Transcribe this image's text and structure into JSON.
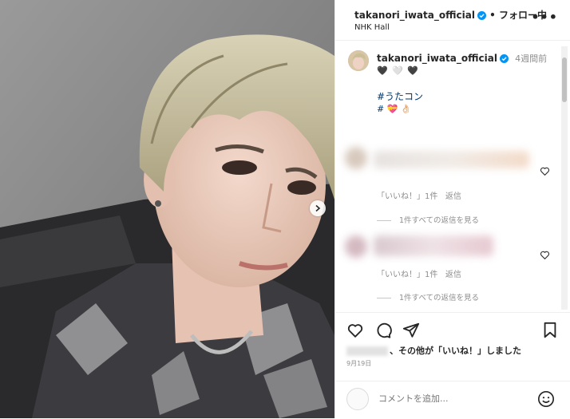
{
  "header": {
    "username": "takanori_iwata_official",
    "separator": "•",
    "follow_status": "フォロー中",
    "location": "NHK Hall",
    "more_label": "•••"
  },
  "caption": {
    "username": "takanori_iwata_official",
    "time": "4週間前",
    "hearts": "🖤 🤍 🖤",
    "hashtag": "#うたコン",
    "emoji_tags": "# 💝 👌🏻"
  },
  "comments": [
    {
      "likes": "「いいね！」1件",
      "reply": "返信",
      "view_replies": "1件すべての返信を見る"
    },
    {
      "likes": "「いいね！」1件",
      "reply": "返信",
      "view_replies": "1件すべての返信を見る"
    }
  ],
  "actions": {
    "likes_text": "、その他が「いいね！」しました",
    "date": "9月19日"
  },
  "add_comment": {
    "placeholder": "コメントを追加..."
  },
  "icons": {
    "verified": "verified-badge-icon",
    "like": "heart-icon",
    "comment": "comment-icon",
    "share": "send-icon",
    "save": "bookmark-icon",
    "emoji": "smile-icon",
    "next": "chevron-right-icon"
  },
  "colors": {
    "verified": "#0095f6",
    "link": "#00376b",
    "muted": "#8e8e8e"
  }
}
